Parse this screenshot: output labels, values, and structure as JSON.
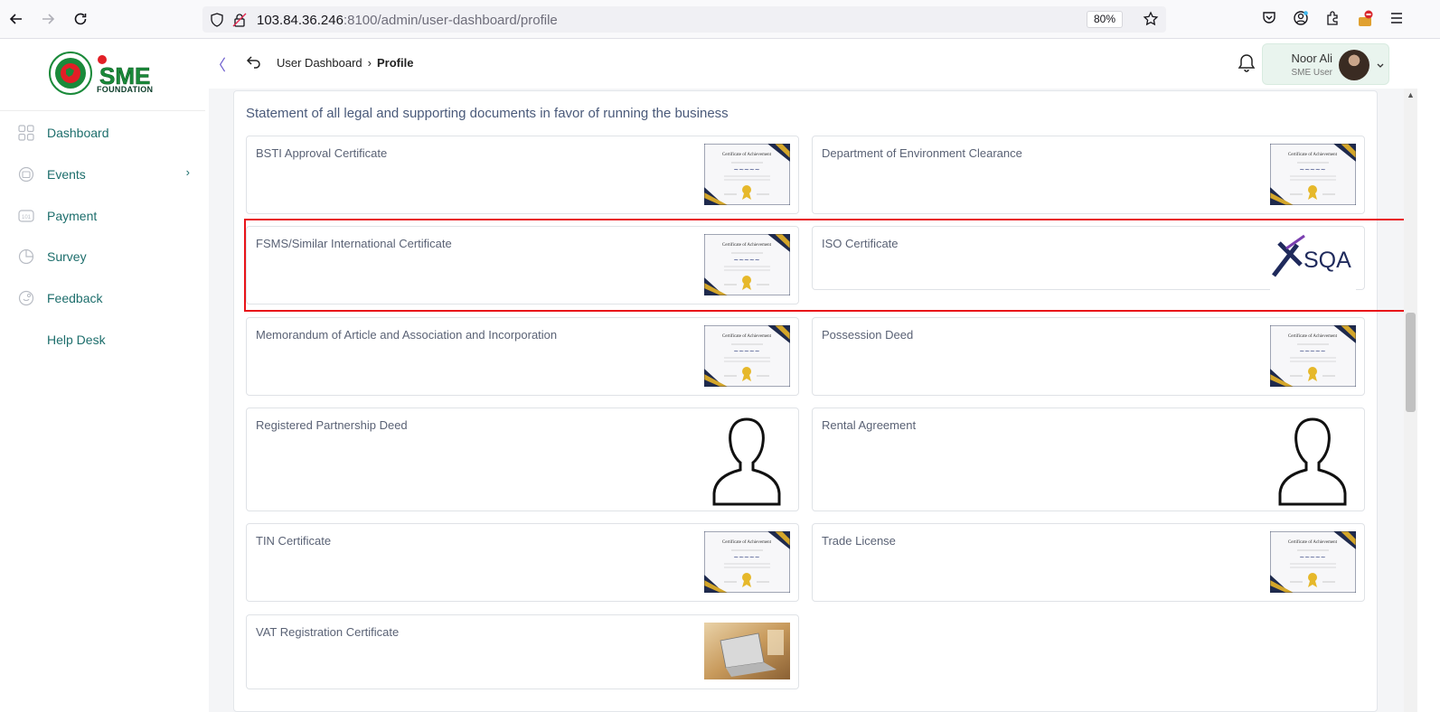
{
  "browser": {
    "url_host": "103.84.36.246",
    "url_path": ":8100/admin/user-dashboard/profile",
    "zoom": "80%"
  },
  "sidebar": {
    "logo_text_top": "SME",
    "logo_text_bottom": "FOUNDATION",
    "items": [
      {
        "label": "Dashboard",
        "icon": "grid-icon"
      },
      {
        "label": "Events",
        "icon": "calendar-icon",
        "chevron": "›"
      },
      {
        "label": "Payment",
        "icon": "payment-icon"
      },
      {
        "label": "Survey",
        "icon": "pie-icon"
      },
      {
        "label": "Feedback",
        "icon": "feedback-icon"
      },
      {
        "label": "Help Desk",
        "icon": ""
      }
    ]
  },
  "header": {
    "collapse_glyph": "〈",
    "breadcrumb_parent": "User Dashboard",
    "breadcrumb_sep": "›",
    "breadcrumb_current": "Profile",
    "user_name": "Noor Ali",
    "user_role": "SME User"
  },
  "section": {
    "title": "Statement of all legal and supporting documents in favor of running the business"
  },
  "documents": [
    {
      "label": "BSTI Approval Certificate",
      "thumb": "certificate"
    },
    {
      "label": "Department of Environment Clearance",
      "thumb": "certificate"
    },
    {
      "label": "FSMS/Similar International Certificate",
      "thumb": "certificate"
    },
    {
      "label": "ISO Certificate",
      "thumb": "sqa-logo"
    },
    {
      "label": "Memorandum of Article and Association and Incorporation",
      "thumb": "certificate"
    },
    {
      "label": "Possession Deed",
      "thumb": "certificate"
    },
    {
      "label": "Registered Partnership Deed",
      "thumb": "person-silhouette"
    },
    {
      "label": "Rental Agreement",
      "thumb": "person-silhouette"
    },
    {
      "label": "TIN Certificate",
      "thumb": "certificate"
    },
    {
      "label": "Trade License",
      "thumb": "certificate"
    },
    {
      "label": "VAT Registration Certificate",
      "thumb": "laptop-photo"
    }
  ],
  "certificate_title": "Certificate of Achievement",
  "sqa_text": "SQA",
  "colors": {
    "accent_teal": "#1d6e6c",
    "highlight_red": "#e8141a",
    "user_pill": "#e9f4ee"
  }
}
